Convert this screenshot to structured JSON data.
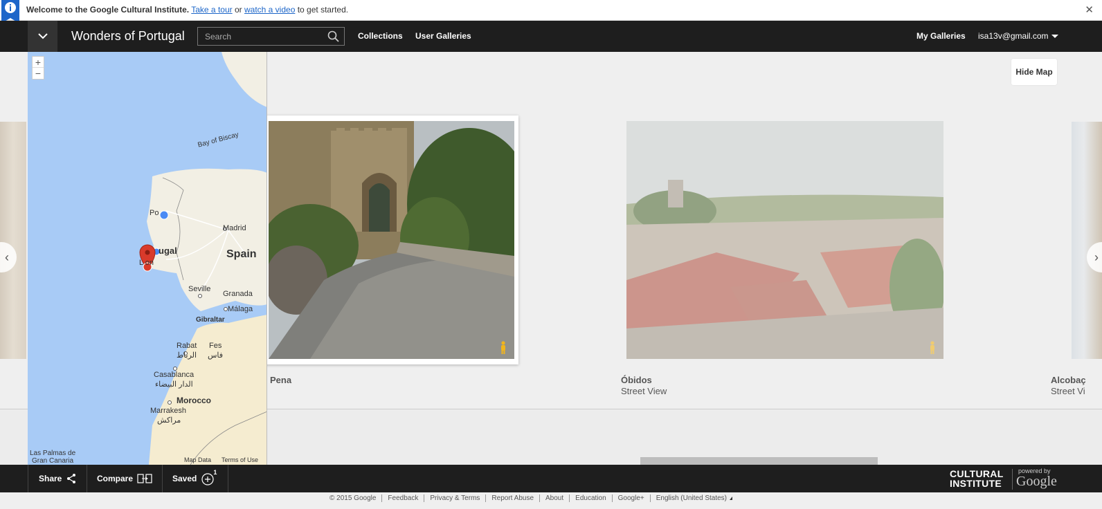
{
  "notification": {
    "prefix": "Welcome to the Google Cultural Institute.",
    "tour_link": "Take a tour",
    "or_text": "or",
    "video_link": "watch a video",
    "suffix": "to get started.",
    "close": "✕"
  },
  "header": {
    "title": "Wonders of Portugal",
    "search_placeholder": "Search",
    "nav": {
      "collections": "Collections",
      "user_galleries": "User Galleries",
      "my_galleries": "My Galleries",
      "account": "isa13v@gmail.com"
    }
  },
  "gallery": {
    "hide_map": "Hide Map",
    "items": [
      {
        "title": "Pena"
      },
      {
        "title": "Óbidos",
        "subtitle": "Street View"
      },
      {
        "title": "Alcobaç",
        "subtitle": "Street Vi"
      }
    ],
    "prev_arrow": "‹",
    "next_arrow": "›"
  },
  "map": {
    "zoom_in": "+",
    "zoom_out": "−",
    "labels": {
      "bay_of_biscay": "Bay of Biscay",
      "porto": "Po",
      "portugal": "ugal",
      "lisbon": "L   on",
      "madrid": "Madrid",
      "spain": "Spain",
      "seville": "Seville",
      "granada": "Granada",
      "malaga": "Málaga",
      "gibraltar": "Gibraltar",
      "rabat": "Rabat",
      "rabat_ar": "الرباط",
      "fes": "Fes",
      "fes_ar": "فاس",
      "casablanca": "Casablanca",
      "casablanca_ar": "الدار البيضاء",
      "morocco": "Morocco",
      "marrakesh": "Marrakesh",
      "marrakesh_ar": "مراكش",
      "las_palmas": "Las Palmas de",
      "gran_canaria": "Gran Canaria"
    },
    "map_data": "Map Data",
    "terms": "Terms of Use",
    "colors": {
      "sea": "#a8cbf6",
      "land": "#f2efe4",
      "marker": "#d93a2b",
      "dot": "#4a8af4"
    }
  },
  "toolbar": {
    "share": "Share",
    "compare": "Compare",
    "saved": "Saved",
    "saved_count": "1",
    "logo_line1": "CULTURAL",
    "logo_line2": "INSTITUTE",
    "powered_by": "powered by",
    "google": "Google"
  },
  "footer": {
    "copyright": "© 2015 Google",
    "links": [
      "Feedback",
      "Privacy & Terms",
      "Report Abuse",
      "About",
      "Education",
      "Google+"
    ],
    "language": "English (United States)"
  }
}
